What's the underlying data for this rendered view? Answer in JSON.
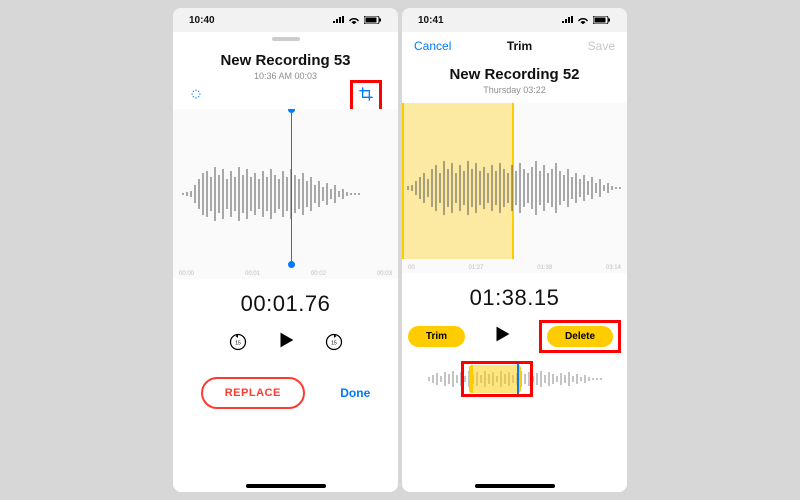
{
  "left": {
    "status_time": "10:40",
    "title": "New Recording 53",
    "subtitle": "10:36 AM  00:03",
    "ticks": [
      "00:00",
      "00:01",
      "00:02",
      "00:03"
    ],
    "big_time": "00:01.76",
    "skip_label": "15",
    "replace_label": "REPLACE",
    "done_label": "Done"
  },
  "right": {
    "status_time": "10:41",
    "nav_cancel": "Cancel",
    "nav_title": "Trim",
    "nav_save": "Save",
    "title": "New Recording 52",
    "subtitle": "Thursday  03:22",
    "ticks": [
      "00",
      "01:27",
      "01:38",
      "03:14"
    ],
    "big_time": "01:38.15",
    "trim_label": "Trim",
    "delete_label": "Delete"
  }
}
